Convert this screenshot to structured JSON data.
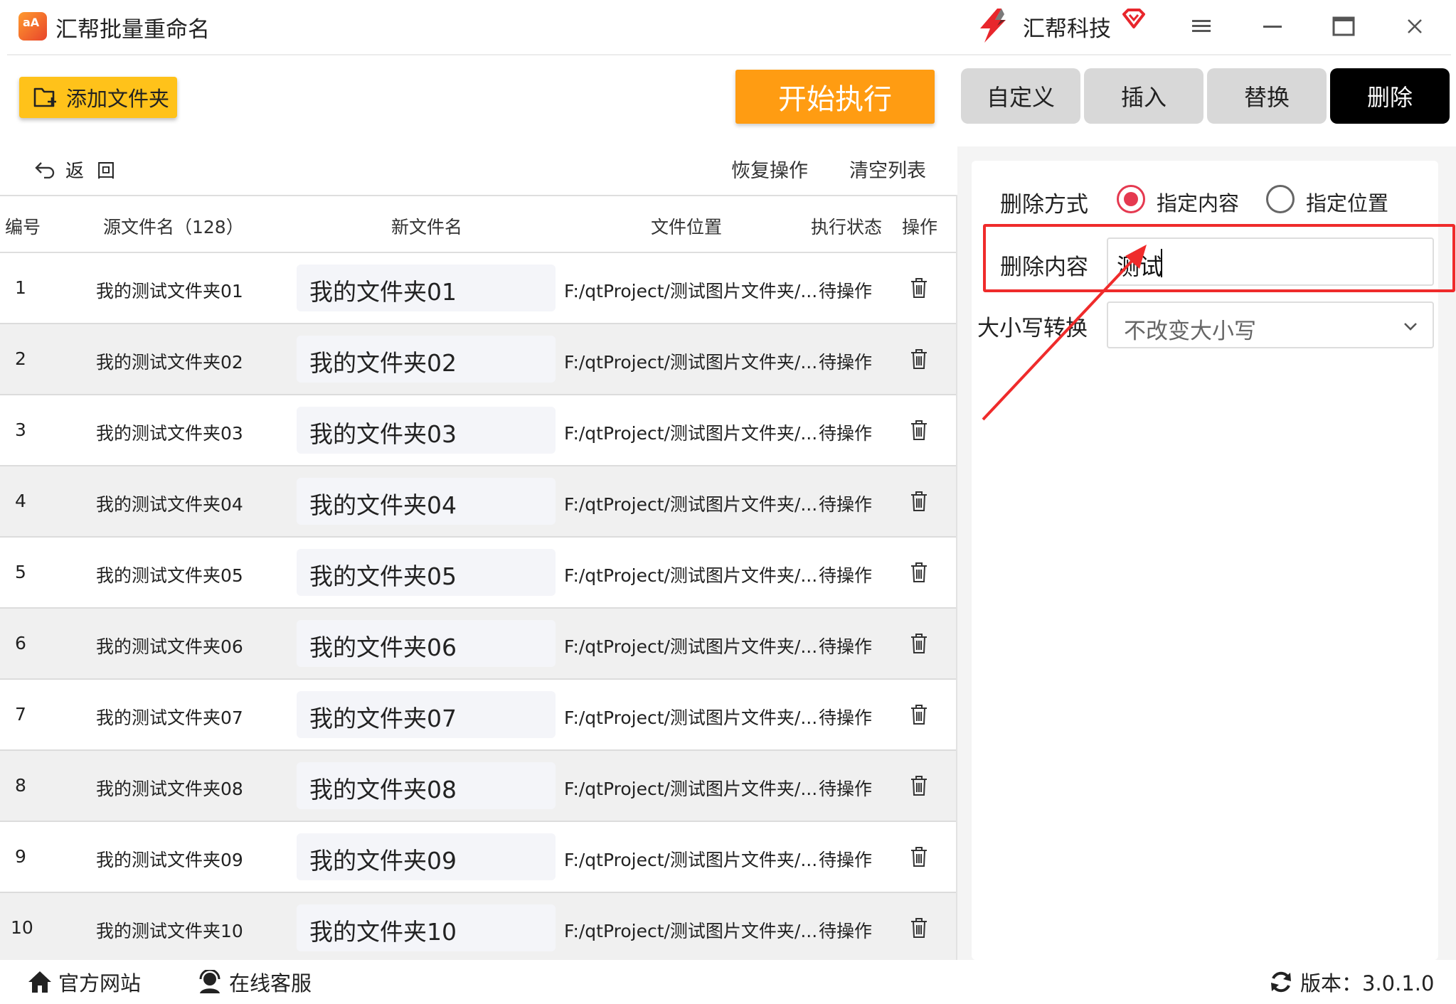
{
  "app": {
    "title": "汇帮批量重命名",
    "brand": "汇帮科技"
  },
  "toolbar": {
    "add_folder": "添加文件夹",
    "start": "开始执行",
    "tabs": [
      {
        "label": "自定义",
        "active": false
      },
      {
        "label": "插入",
        "active": false
      },
      {
        "label": "替换",
        "active": false
      },
      {
        "label": "删除",
        "active": true
      }
    ]
  },
  "list_toolbar": {
    "back": "返回",
    "restore": "恢复操作",
    "clear": "清空列表"
  },
  "table": {
    "headers": [
      "编号",
      "源文件名（128）",
      "新文件名",
      "文件位置",
      "执行状态",
      "操作"
    ],
    "rows": [
      {
        "no": "1",
        "src": "我的测试文件夹01",
        "new": "我的文件夹01",
        "loc": "F:/qtProject/测试图片文件夹/...",
        "status": "待操作"
      },
      {
        "no": "2",
        "src": "我的测试文件夹02",
        "new": "我的文件夹02",
        "loc": "F:/qtProject/测试图片文件夹/...",
        "status": "待操作"
      },
      {
        "no": "3",
        "src": "我的测试文件夹03",
        "new": "我的文件夹03",
        "loc": "F:/qtProject/测试图片文件夹/...",
        "status": "待操作"
      },
      {
        "no": "4",
        "src": "我的测试文件夹04",
        "new": "我的文件夹04",
        "loc": "F:/qtProject/测试图片文件夹/...",
        "status": "待操作"
      },
      {
        "no": "5",
        "src": "我的测试文件夹05",
        "new": "我的文件夹05",
        "loc": "F:/qtProject/测试图片文件夹/...",
        "status": "待操作"
      },
      {
        "no": "6",
        "src": "我的测试文件夹06",
        "new": "我的文件夹06",
        "loc": "F:/qtProject/测试图片文件夹/...",
        "status": "待操作"
      },
      {
        "no": "7",
        "src": "我的测试文件夹07",
        "new": "我的文件夹07",
        "loc": "F:/qtProject/测试图片文件夹/...",
        "status": "待操作"
      },
      {
        "no": "8",
        "src": "我的测试文件夹08",
        "new": "我的文件夹08",
        "loc": "F:/qtProject/测试图片文件夹/...",
        "status": "待操作"
      },
      {
        "no": "9",
        "src": "我的测试文件夹09",
        "new": "我的文件夹09",
        "loc": "F:/qtProject/测试图片文件夹/...",
        "status": "待操作"
      },
      {
        "no": "10",
        "src": "我的测试文件夹10",
        "new": "我的文件夹10",
        "loc": "F:/qtProject/测试图片文件夹/...",
        "status": "待操作"
      }
    ]
  },
  "delete_panel": {
    "mode_label": "删除方式",
    "mode_options": [
      "指定内容",
      "指定位置"
    ],
    "mode_selected": "指定内容",
    "content_label": "删除内容",
    "content_value": "测试",
    "case_label": "大小写转换",
    "case_value": "不改变大小写"
  },
  "footer": {
    "official_site": "官方网站",
    "support": "在线客服",
    "version": "版本：3.0.1.0"
  },
  "colors": {
    "accent_orange": "#ff9c12",
    "add_folder_yellow": "#ffc21a",
    "radio_red": "#e53950",
    "highlight_red": "#ef2b2b",
    "active_tab": "#000000"
  }
}
